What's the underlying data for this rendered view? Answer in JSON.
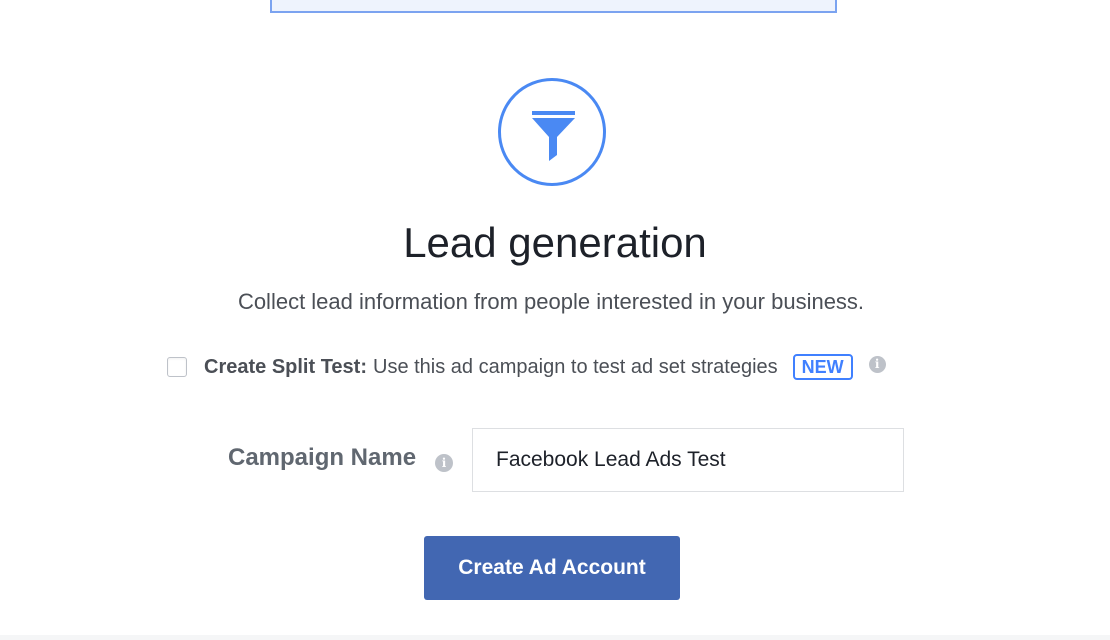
{
  "objective": {
    "icon": "funnel-icon",
    "title": "Lead generation",
    "description": "Collect lead information from people interested in your business."
  },
  "split_test": {
    "checked": false,
    "label": "Create Split Test:",
    "description": "Use this ad campaign to test ad set strategies",
    "badge": "NEW",
    "info_icon": "info-icon"
  },
  "campaign_name": {
    "label": "Campaign Name",
    "value": "Facebook Lead Ads Test",
    "info_icon": "info-icon"
  },
  "create_button": {
    "label": "Create Ad Account"
  },
  "colors": {
    "accent_blue": "#4a89f3",
    "badge_blue": "#4080ff",
    "button_blue": "#4267b2",
    "text_dark": "#1d2129",
    "text_gray": "#4b4f56"
  }
}
